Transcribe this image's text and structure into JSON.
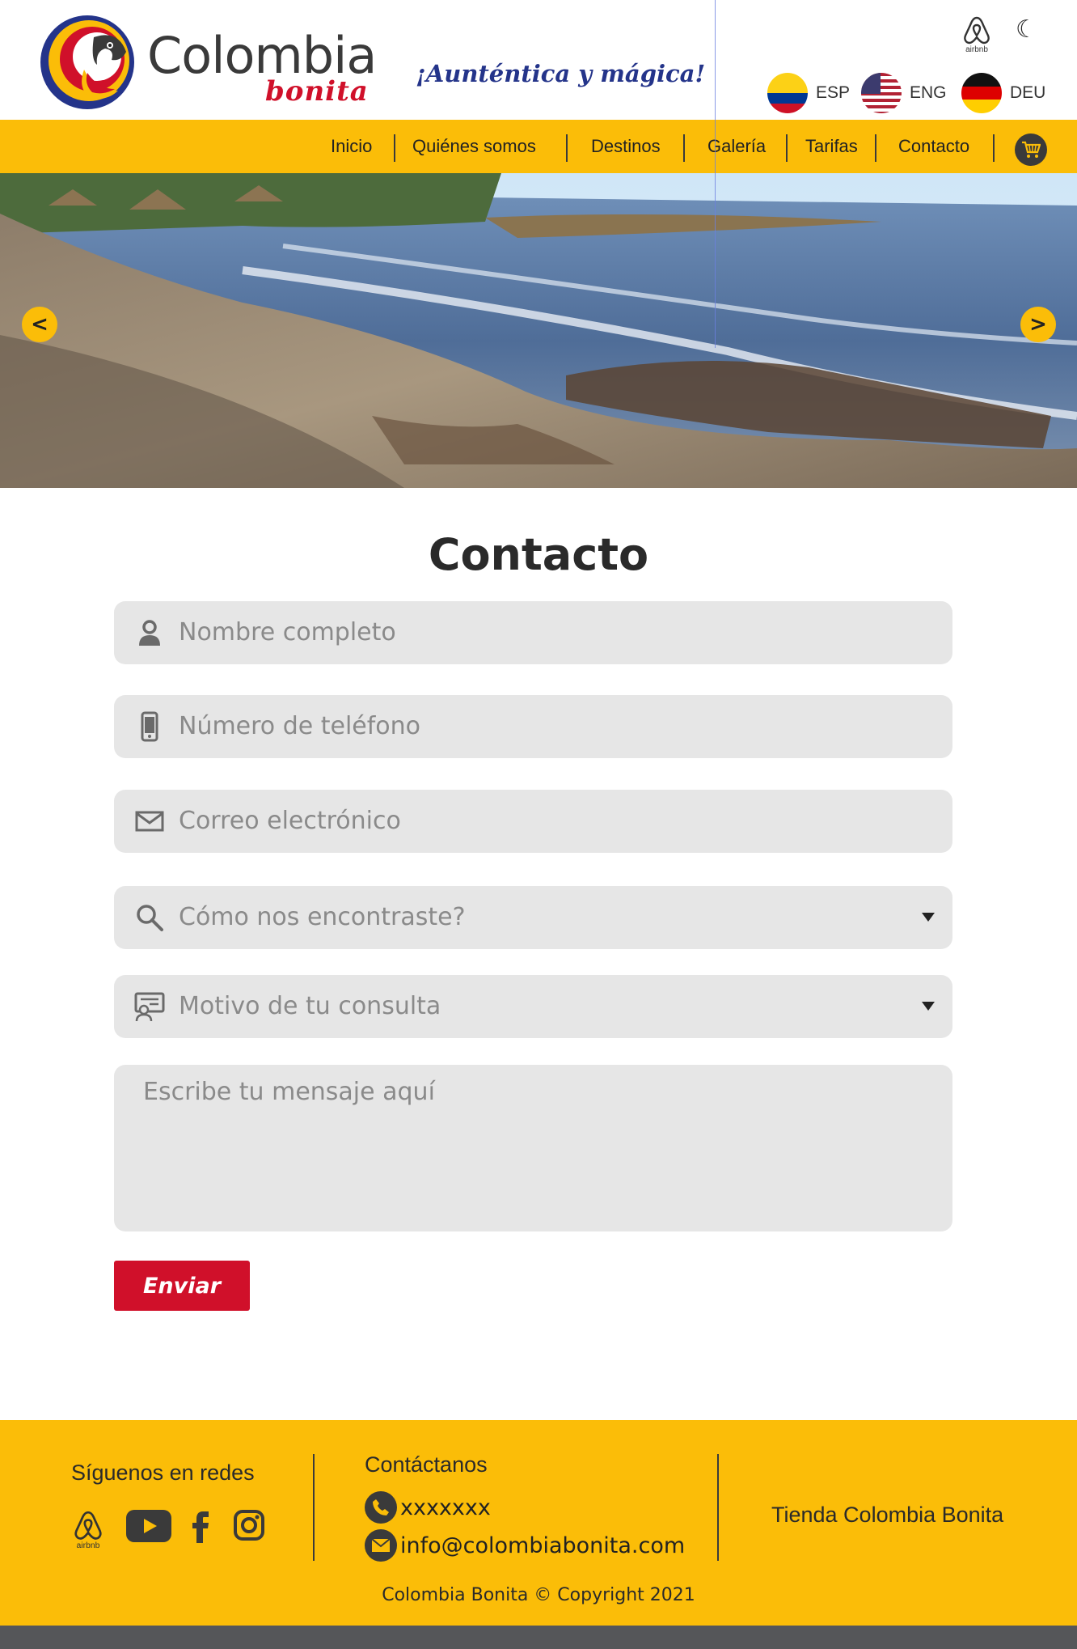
{
  "brand": {
    "name": "Colombia",
    "sub": "bonita",
    "tagline": "¡Aunténtica y mágica!"
  },
  "header": {
    "airbnb_label": "airbnb",
    "languages": [
      {
        "code": "ESP"
      },
      {
        "code": "ENG"
      },
      {
        "code": "DEU"
      }
    ]
  },
  "nav": {
    "items": [
      "Inicio",
      "Quiénes somos",
      "Destinos",
      "Galería",
      "Tarifas",
      "Contacto"
    ]
  },
  "hero": {
    "prev_label": "<",
    "next_label": ">"
  },
  "contact": {
    "title": "Contacto",
    "name_placeholder": "Nombre completo",
    "phone_placeholder": "Número de teléfono",
    "email_placeholder": "Correo electrónico",
    "source_select": "Cómo nos encontraste?",
    "reason_select": "Motivo de tu consulta",
    "message_placeholder": "Escribe tu mensaje aquí",
    "submit_label": "Enviar"
  },
  "footer": {
    "social_title": "Síguenos en redes",
    "airbnb_label": "airbnb",
    "contact_title": "Contáctanos",
    "phone": "xxxxxxx",
    "email": "info@colombiabonita.com",
    "shop": "Tienda Colombia Bonita",
    "copyright": "Colombia Bonita © Copyright 2021"
  },
  "colors": {
    "accent_yellow": "#fbbd08",
    "brand_red": "#d0102a",
    "tagline_blue": "#24348a",
    "field_gray": "#e6e6e6"
  }
}
